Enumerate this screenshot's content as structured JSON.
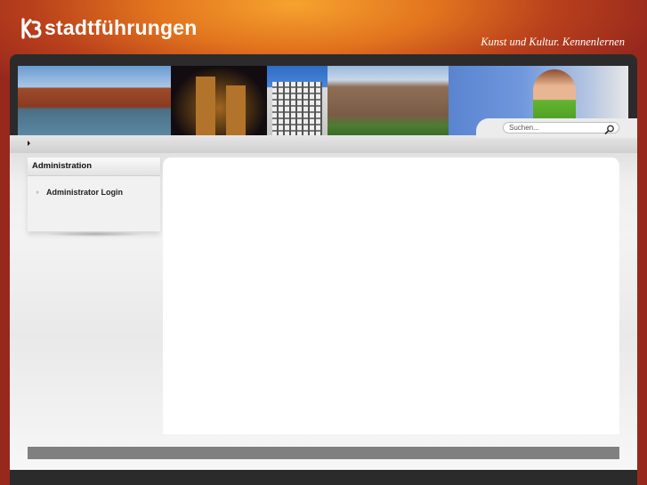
{
  "header": {
    "logo_text": "stadtführungen",
    "logo_icon": "logo-mark-icon",
    "tagline": "Kunst und Kultur. Kennenlernen"
  },
  "search": {
    "placeholder": "Suchen...",
    "icon": "search-icon"
  },
  "nav": {
    "breadcrumb_icon": "triangle-right-icon"
  },
  "sidebar": {
    "title": "Administration",
    "items": [
      {
        "label": "Administrator Login"
      }
    ]
  },
  "colors": {
    "background_accent": "#e2741e",
    "background_dark": "#8e2419",
    "footer_bar": "#808080"
  }
}
